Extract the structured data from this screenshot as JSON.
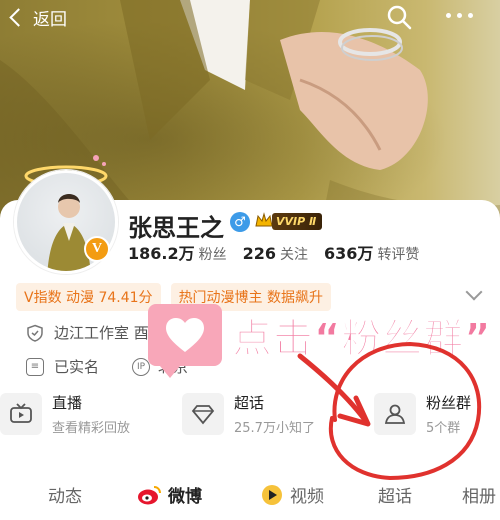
{
  "topbar": {
    "back_label": "返回"
  },
  "profile": {
    "name": "张思王之",
    "vip_tag": "VVIP Ⅱ",
    "verified_letter": "V",
    "stats": [
      {
        "value": "186.2万",
        "label": "粉丝"
      },
      {
        "value": "226",
        "label": "关注"
      },
      {
        "value": "636万",
        "label": "转评赞"
      }
    ]
  },
  "tags": [
    "V指数 动漫 74.41分",
    "热门动漫博主 数据飙升"
  ],
  "info": {
    "studio": "边江工作室 酉",
    "verified": "已实名",
    "location": "北京",
    "location_icon_label": "IP"
  },
  "annotation": {
    "text": "点击“粉丝群”"
  },
  "shortcuts": [
    {
      "title": "直播",
      "sub": "查看精彩回放",
      "icon": "tv-icon"
    },
    {
      "title": "超话",
      "sub": "25.7万小知了",
      "icon": "diamond-icon"
    },
    {
      "title": "粉丝群",
      "sub": "5个群",
      "icon": "group-icon"
    }
  ],
  "tabs": [
    "动态",
    "微博",
    "视频",
    "超话",
    "相册"
  ],
  "active_tab": "微博",
  "colors": {
    "accent_orange": "#e8741a",
    "annotation_pink": "#f27aa0",
    "annotation_red": "#e0322e"
  }
}
